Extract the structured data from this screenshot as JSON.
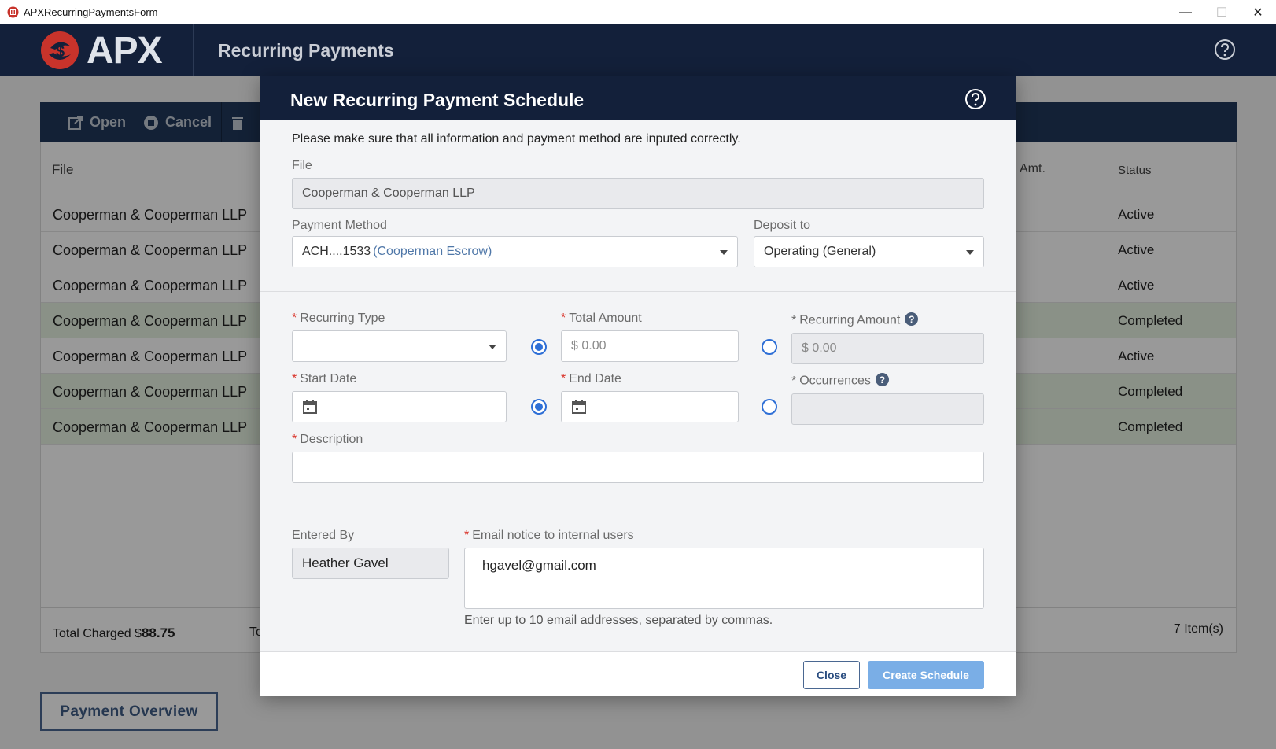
{
  "window": {
    "title": "APXRecurringPaymentsForm",
    "controls": {
      "minimize": "—",
      "maximize": "☐",
      "close": "✕"
    }
  },
  "header": {
    "logo_text": "APX",
    "title": "Recurring Payments",
    "help_icon": "question-circle-icon"
  },
  "background": {
    "toolbar": [
      {
        "label": "Open",
        "icon": "open-external-icon"
      },
      {
        "label": "Cancel",
        "icon": "cancel-circle-icon"
      },
      {
        "label": "",
        "icon": "trash-icon"
      }
    ],
    "columns": {
      "file": "File",
      "amount": "Amt.",
      "status": "Status"
    },
    "rows": [
      {
        "file": "Cooperman & Cooperman LLP",
        "status": "Active"
      },
      {
        "file": "Cooperman & Cooperman LLP",
        "status": "Active"
      },
      {
        "file": "Cooperman & Cooperman LLP",
        "status": "Active"
      },
      {
        "file": "Cooperman & Cooperman LLP",
        "status": "Completed"
      },
      {
        "file": "Cooperman & Cooperman LLP",
        "status": "Active"
      },
      {
        "file": "Cooperman & Cooperman LLP",
        "status": "Completed"
      },
      {
        "file": "Cooperman & Cooperman LLP",
        "status": "Completed"
      }
    ],
    "footer": {
      "total_charged_label": "Total Charged $",
      "total_charged_value": "88.75",
      "truncated_label": "To",
      "item_count": "7 Item(s)"
    },
    "payment_overview_label": "Payment Overview"
  },
  "modal": {
    "title": "New Recurring Payment Schedule",
    "intro": "Please make sure that all information and payment method are inputed correctly.",
    "file": {
      "label": "File",
      "value": "Cooperman & Cooperman LLP"
    },
    "payment_method": {
      "label": "Payment Method",
      "value": "ACH....1533",
      "note": "(Cooperman Escrow)"
    },
    "deposit_to": {
      "label": "Deposit to",
      "value": "Operating (General)"
    },
    "required_mark": "*",
    "recurring_type": {
      "label": "Recurring Type",
      "value": ""
    },
    "total_amount": {
      "label": "Total Amount",
      "placeholder": "$ 0.00",
      "selected": true
    },
    "recurring_amount": {
      "label": "Recurring Amount",
      "placeholder": "$ 0.00",
      "selected": false
    },
    "start_date": {
      "label": "Start Date",
      "value": ""
    },
    "end_date": {
      "label": "End Date",
      "value": "",
      "selected": true
    },
    "occurrences": {
      "label": "Occurrences",
      "value": "",
      "selected": false
    },
    "description": {
      "label": "Description",
      "value": ""
    },
    "entered_by": {
      "label": "Entered By",
      "value": "Heather Gavel"
    },
    "email_notice": {
      "label": "Email notice to internal users",
      "value": "hgavel@gmail.com",
      "hint": "Enter up to 10 email addresses, separated by commas."
    },
    "buttons": {
      "close": "Close",
      "create": "Create Schedule"
    }
  },
  "colors": {
    "header_bg": "#13203a",
    "toolbar_bg": "#20375b",
    "accent_blue": "#2e6fd6",
    "completed_row": "#e6f2e2",
    "required": "#d9342b"
  }
}
